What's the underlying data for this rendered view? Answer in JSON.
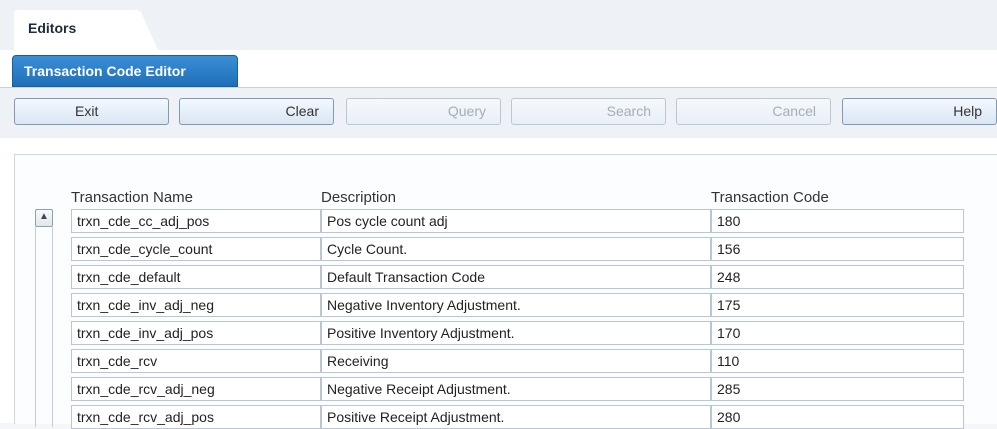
{
  "top_tab": {
    "label": "Editors"
  },
  "editor_tab": {
    "label": "Transaction Code Editor"
  },
  "toolbar": {
    "exit": "Exit",
    "clear": "Clear",
    "query": "Query",
    "search": "Search",
    "cancel": "Cancel",
    "help": "Help"
  },
  "grid": {
    "columns": [
      "Transaction Name",
      "Description",
      "Transaction Code"
    ],
    "rows": [
      {
        "name": "trxn_cde_cc_adj_pos",
        "description": "Pos cycle count adj",
        "code": "180"
      },
      {
        "name": "trxn_cde_cycle_count",
        "description": "Cycle Count.",
        "code": "156"
      },
      {
        "name": "trxn_cde_default",
        "description": "Default Transaction Code",
        "code": "248"
      },
      {
        "name": "trxn_cde_inv_adj_neg",
        "description": "Negative Inventory Adjustment.",
        "code": "175"
      },
      {
        "name": "trxn_cde_inv_adj_pos",
        "description": "Positive Inventory Adjustment.",
        "code": "170"
      },
      {
        "name": "trxn_cde_rcv",
        "description": "Receiving",
        "code": "110"
      },
      {
        "name": "trxn_cde_rcv_adj_neg",
        "description": "Negative Receipt Adjustment.",
        "code": "285"
      },
      {
        "name": "trxn_cde_rcv_adj_pos",
        "description": "Positive Receipt Adjustment.",
        "code": "280"
      }
    ]
  },
  "icons": {
    "scroll_up": "arrow-up-icon"
  },
  "colors": {
    "accent": "#1f6fb8",
    "cell_border": "#b9c6d4"
  }
}
